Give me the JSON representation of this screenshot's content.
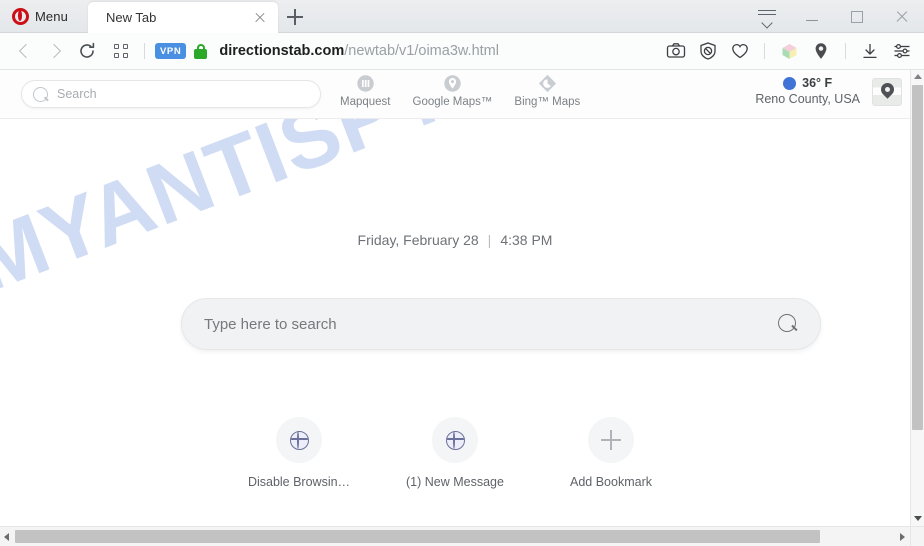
{
  "browser": {
    "menu_label": "Menu",
    "tab_title": "New Tab",
    "url_domain": "directionstab.com",
    "url_path": "/newtab/v1/oima3w.html",
    "vpn_label": "VPN",
    "icons": {
      "opera_logo": "opera-logo",
      "tab_close": "close-icon",
      "new_tab": "plus-icon",
      "back": "back-arrow-icon",
      "forward": "forward-arrow-icon",
      "reload": "reload-icon",
      "speed_dial": "grid-icon",
      "lock": "padlock-icon",
      "snapshot": "camera-icon",
      "ad_block": "shield-block-icon",
      "favorites": "heart-icon",
      "extension": "cube-extension-icon",
      "location": "map-pin-icon",
      "downloads": "download-icon",
      "easy_setup": "sliders-icon",
      "tab_menu": "tab-menu-icon",
      "minimize": "minimize-icon",
      "maximize": "maximize-icon",
      "close_window": "window-close-icon"
    }
  },
  "site": {
    "watermark": "MYANTISPYWARE.COM",
    "header": {
      "search_placeholder": "Search",
      "nav": [
        {
          "label": "Mapquest",
          "icon": "mapquest-icon"
        },
        {
          "label": "Google Maps™",
          "icon": "google-maps-pin-icon"
        },
        {
          "label": "Bing™ Maps",
          "icon": "bing-maps-icon"
        }
      ],
      "weather": {
        "temperature": "36° F",
        "location": "Reno County, USA",
        "condition_icon": "weather-circle-icon",
        "map_button_icon": "map-pin-thumbnail-icon"
      }
    },
    "datetime": {
      "date": "Friday, February 28",
      "separator": "|",
      "time": "4:38 PM"
    },
    "main_search": {
      "placeholder": "Type here to search",
      "submit_icon": "search-icon"
    },
    "shortcuts": [
      {
        "label": "Disable Browsin…",
        "icon": "globe-icon"
      },
      {
        "label": "(1) New Message",
        "icon": "globe-icon"
      },
      {
        "label": "Add Bookmark",
        "icon": "plus-icon"
      }
    ]
  },
  "colors": {
    "opera_red": "#cc0f16",
    "vpn_blue": "#4a90e2",
    "lock_green": "#2aa828",
    "weather_blue": "#3f74d6",
    "watermark_blue": "#c6d5f2"
  }
}
